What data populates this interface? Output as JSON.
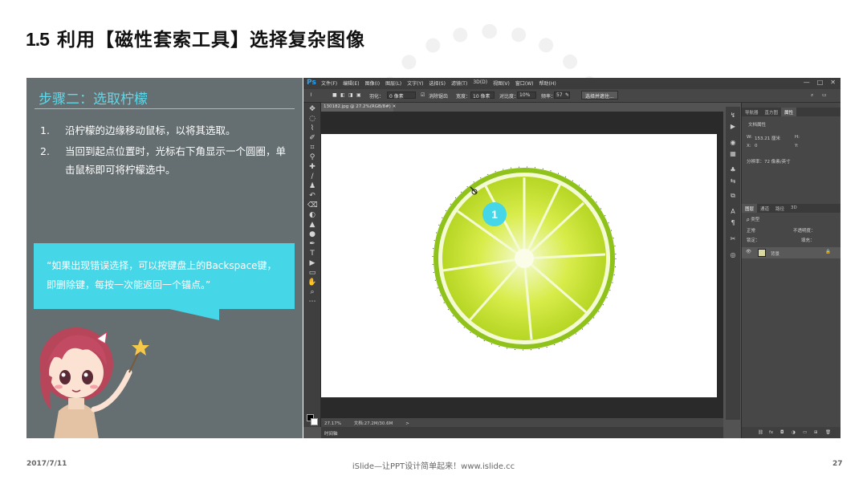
{
  "slide": {
    "number": "1.5",
    "title": "利用【磁性套索工具】选择复杂图像"
  },
  "left_panel": {
    "step_heading": "步骤二：选取柠檬",
    "steps": [
      {
        "index": "1.",
        "text": "沿柠檬的边缘移动鼠标，以将其选取。"
      },
      {
        "index": "2.",
        "text": "当回到起点位置时，光标右下角显示一个圆圈，单击鼠标即可将柠檬选中。"
      }
    ],
    "tip": "“如果出现错误选择，可以按键盘上的Backspace键，即删除键，每按一次能返回一个锚点。”"
  },
  "photoshop": {
    "logo": "Ps",
    "menus": [
      "文件(F)",
      "编辑(E)",
      "图像(I)",
      "图层(L)",
      "文字(Y)",
      "选择(S)",
      "滤镜(T)",
      "3D(D)",
      "视图(V)",
      "窗口(W)",
      "帮助(H)"
    ],
    "window_controls": [
      "—",
      "□",
      "✕"
    ],
    "options": {
      "feather_label": "羽化：",
      "feather_value": "0 像素",
      "antialias_label": "消除锯齿",
      "width_label": "宽度：",
      "width_value": "10 像素",
      "contrast_label": "对比度：",
      "contrast_value": "10%",
      "frequency_label": "频率：",
      "frequency_value": "57",
      "select_mask_button": "选择并遮住..."
    },
    "doc_tab": "130182.jpg @ 27.2%(RGB/8#)",
    "status": {
      "zoom": "27.17%",
      "doc_size": "文档:27.2M/30.6M",
      "arrow": ">"
    },
    "timeline_label": "时间轴",
    "canvas_marker": "1",
    "panels": {
      "top_tabs": [
        "导航器",
        "直方图",
        "属性"
      ],
      "active_top_tab": "属性",
      "doc_props_label": "文档属性",
      "w_label": "W:",
      "w_value": "153.21 厘米",
      "h_label": "H:",
      "x_label": "X:",
      "x_value": "0",
      "y_label": "Y:",
      "resolution": "分辨率：72 像素/英寸",
      "layer_tabs": [
        "图层",
        "通道",
        "路径",
        "3D"
      ],
      "kind_label": "ρ 类型",
      "blend_mode": "正常",
      "opacity_label": "不透明度：",
      "lock_label": "锁定：",
      "fill_label": "填充：",
      "layer_name": "背景",
      "layer_lock": "🔒"
    }
  },
  "footer": {
    "date": "2017/7/11",
    "center": "iSlide—让PPT设计简单起来！www.islide.cc",
    "page": "27"
  },
  "colors": {
    "accent_cyan": "#45d6e8",
    "panel_gray": "#656e70",
    "ps_dark": "#535353",
    "lime": "#b6d624"
  }
}
